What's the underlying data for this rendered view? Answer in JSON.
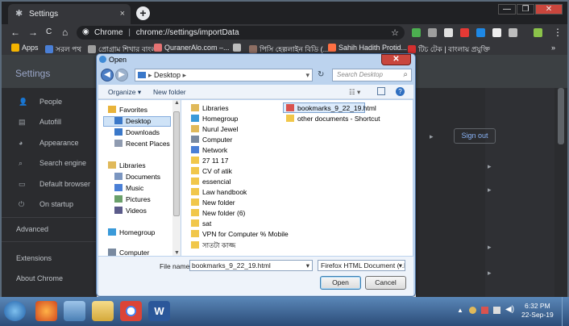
{
  "browser": {
    "tab_title": "Settings",
    "tab_close": "×",
    "new_tab": "+",
    "window_controls": [
      "—",
      "❐",
      "✕"
    ],
    "nav": {
      "back": "←",
      "forward": "→",
      "reload": "C",
      "home": "⌂"
    },
    "url_prefix": "Chrome",
    "url_sep": "|",
    "url_path": "chrome://settings/importData",
    "star": "☆",
    "menu": "⋮"
  },
  "bookmarks": [
    {
      "label": "Apps",
      "color": "#f4b400"
    },
    {
      "label": "সরল পথ",
      "color": "#4a7fd6"
    },
    {
      "label": "প্রোগ্রাম শিখার বাংলা",
      "color": "#9e9e9e"
    },
    {
      "label": "QuranerAlo.com –...",
      "color": "#e57373"
    },
    {
      "label": "",
      "color": "#bdbdbd"
    },
    {
      "label": "পিসি হেল্পলাইন বিডি (...",
      "color": "#8d6e63"
    },
    {
      "label": "Sahih Hadith Protid...",
      "color": "#ff7043"
    },
    {
      "label": "টিচ টেক | বাংলায় প্রযুক্তি",
      "color": "#d32f2f"
    }
  ],
  "bookmarks_more": "»",
  "settings": {
    "title": "Settings",
    "sidebar": [
      {
        "icon": "person-icon",
        "glyph": "👤",
        "label": "People"
      },
      {
        "icon": "autofill-icon",
        "glyph": "▤",
        "label": "Autofill"
      },
      {
        "icon": "palette-icon",
        "glyph": "◕",
        "label": "Appearance"
      },
      {
        "icon": "search-icon",
        "glyph": "⌕",
        "label": "Search engine"
      },
      {
        "icon": "browser-icon",
        "glyph": "▭",
        "label": "Default browser"
      },
      {
        "icon": "power-icon",
        "glyph": "⏻",
        "label": "On startup"
      }
    ],
    "advanced": "Advanced",
    "extensions": "Extensions",
    "about": "About Chrome",
    "sign_out": "Sign out"
  },
  "dialog": {
    "title": "Open",
    "close": "✕",
    "address": "Desktop",
    "search_placeholder": "Search Desktop",
    "organize": "Organize ▾",
    "new_folder": "New folder",
    "nav_items": [
      {
        "label": "Favorites",
        "icon": "star-icon",
        "color": "#e8b33a"
      },
      {
        "label": "Desktop",
        "icon": "desktop-icon",
        "color": "#3a78c9"
      },
      {
        "label": "Downloads",
        "icon": "downloads-icon",
        "color": "#3a78c9"
      },
      {
        "label": "Recent Places",
        "icon": "recent-places-icon",
        "color": "#8f9bb0"
      },
      {
        "label": "Libraries",
        "icon": "libraries-icon",
        "color": "#e0b95a"
      },
      {
        "label": "Documents",
        "icon": "documents-icon",
        "color": "#7a95c0"
      },
      {
        "label": "Music",
        "icon": "music-icon",
        "color": "#4a7fd6"
      },
      {
        "label": "Pictures",
        "icon": "pictures-icon",
        "color": "#6aa06a"
      },
      {
        "label": "Videos",
        "icon": "videos-icon",
        "color": "#5b5b8a"
      },
      {
        "label": "Homegroup",
        "icon": "homegroup-icon",
        "color": "#3a9ad9"
      },
      {
        "label": "Computer",
        "icon": "computer-icon",
        "color": "#7a8aa0"
      }
    ],
    "files_col1": [
      {
        "label": "Libraries",
        "color": "#e0b95a"
      },
      {
        "label": "Homegroup",
        "color": "#3a9ad9"
      },
      {
        "label": "Nurul Jewel",
        "color": "#e0b95a"
      },
      {
        "label": "Computer",
        "color": "#7a8aa0"
      },
      {
        "label": "Network",
        "color": "#4a7fd6"
      },
      {
        "label": "27 11 17",
        "color": "#f1c74a"
      },
      {
        "label": "CV of atik",
        "color": "#f1c74a"
      },
      {
        "label": "essencial",
        "color": "#f1c74a"
      },
      {
        "label": "Law handbook",
        "color": "#f1c74a"
      },
      {
        "label": "New folder",
        "color": "#f1c74a"
      },
      {
        "label": "New folder (6)",
        "color": "#f1c74a"
      },
      {
        "label": "sat",
        "color": "#f1c74a"
      },
      {
        "label": "VPN for Computer % Mobile",
        "color": "#f1c74a"
      },
      {
        "label": "সাতটা কাজ্জ",
        "color": "#f1c74a"
      }
    ],
    "files_col2": [
      {
        "label": "bookmarks_9_22_19.html",
        "color": "#d9534f"
      },
      {
        "label": "other documents - Shortcut",
        "color": "#f1c74a"
      }
    ],
    "filename_label": "File name:",
    "filename_value": "bookmarks_9_22_19.html",
    "filetype_value": "Firefox HTML Document (*.h",
    "open_button": "Open",
    "cancel_button": "Cancel"
  },
  "taskbar": {
    "time": "6:32 PM",
    "date": "22-Sep-19"
  }
}
